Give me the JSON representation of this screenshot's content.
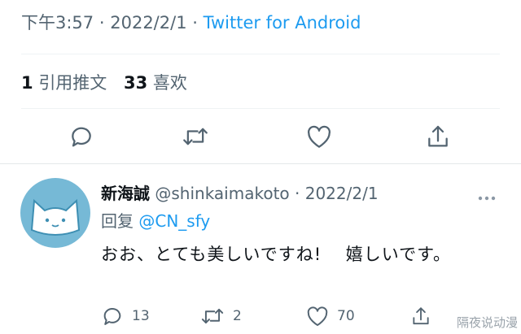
{
  "tweet": {
    "time": "下午3:57",
    "date": "2022/2/1",
    "separator": "·",
    "source": "Twitter for Android",
    "stats": {
      "quote_count": "1",
      "quote_label": "引用推文",
      "like_count": "33",
      "like_label": "喜欢"
    },
    "actions": [
      "reply-icon",
      "retweet-icon",
      "like-icon",
      "share-icon"
    ]
  },
  "reply": {
    "display_name": "新海誠",
    "handle": "@shinkaimakoto",
    "date": "2022/2/1",
    "replying_prefix": "回复",
    "replying_to": "@CN_sfy",
    "text": "おお、とても美しいですね!　 嬉しいです。",
    "reply_count": "13",
    "retweet_count": "2",
    "like_count": "70"
  },
  "watermark": "隔夜说动漫",
  "colors": {
    "accent": "#1d9bf0",
    "muted": "#536471",
    "avatar": "#76b9d6"
  }
}
